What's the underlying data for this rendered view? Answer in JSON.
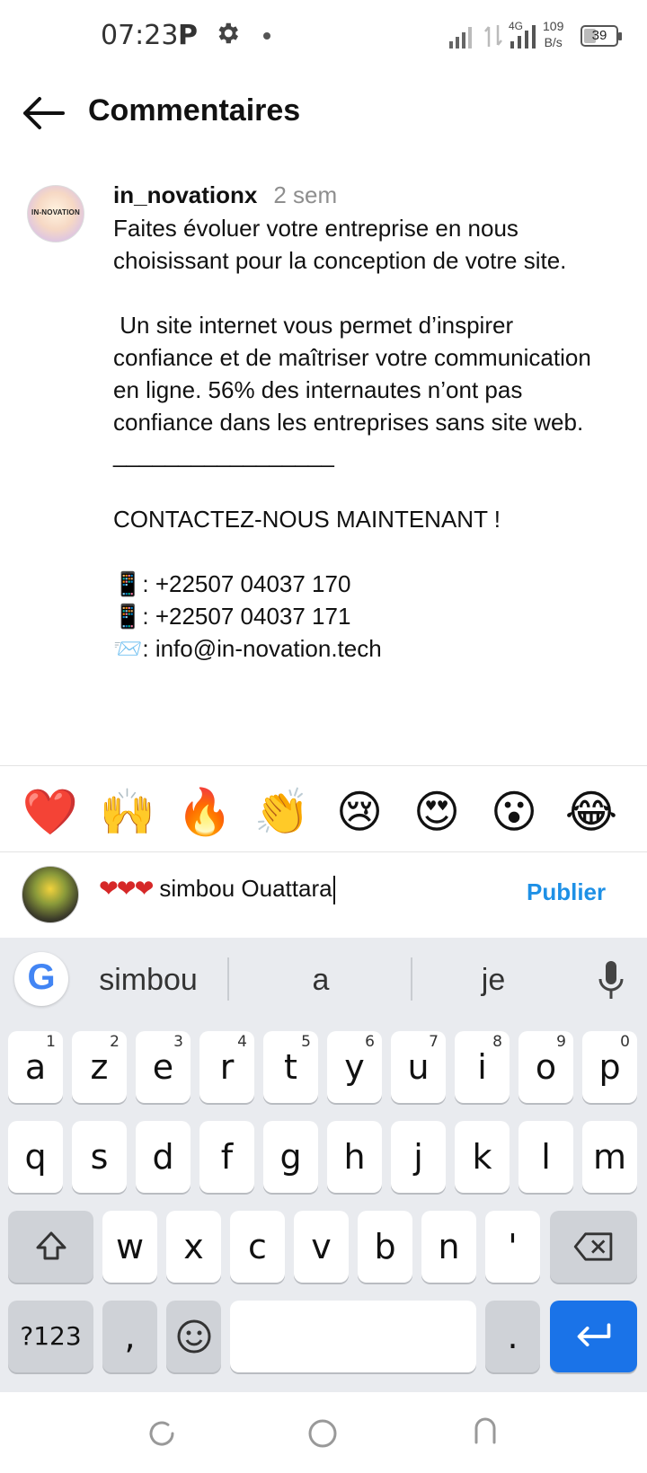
{
  "status_bar": {
    "time": "07:23",
    "notification_letter": "P",
    "network_label": "4G",
    "speed_value": "109",
    "speed_unit": "B/s",
    "battery_level": "39",
    "icons": [
      "gear-icon",
      "signal-icon",
      "data-arrows-icon",
      "battery-icon"
    ]
  },
  "header": {
    "title": "Commentaires",
    "back_icon": "arrow-left-icon"
  },
  "post": {
    "avatar_text": "IN-NOVATION",
    "username": "in_novationx",
    "time": "2 sem",
    "caption": "Faites évoluer votre entreprise en nous choisissant pour la conception de votre site.\n\n Un site internet vous permet d’inspirer confiance et de maîtriser votre communication en ligne. 56% des internautes n’ont pas confiance dans les entreprises sans site web.\n_________________\n\nCONTACTEZ-NOUS MAINTENANT !\n\n📱: +22507 04037 170\n📱: +22507 04037 171\n📨: info@in-novation.tech"
  },
  "emoji_bar": [
    "❤️",
    "🙌",
    "🔥",
    "👏",
    "😢",
    "😍",
    "😮",
    "😂"
  ],
  "comment": {
    "hearts": "❤❤❤",
    "text": "simbou Ouattara",
    "publish_label": "Publier"
  },
  "keyboard": {
    "google_letter": "G",
    "suggestions": [
      "simbou",
      "a",
      "je"
    ],
    "row1": [
      {
        "k": "a",
        "n": "1"
      },
      {
        "k": "z",
        "n": "2"
      },
      {
        "k": "e",
        "n": "3"
      },
      {
        "k": "r",
        "n": "4"
      },
      {
        "k": "t",
        "n": "5"
      },
      {
        "k": "y",
        "n": "6"
      },
      {
        "k": "u",
        "n": "7"
      },
      {
        "k": "i",
        "n": "8"
      },
      {
        "k": "o",
        "n": "9"
      },
      {
        "k": "p",
        "n": "0"
      }
    ],
    "row2": [
      "q",
      "s",
      "d",
      "f",
      "g",
      "h",
      "j",
      "k",
      "l",
      "m"
    ],
    "row3": [
      "w",
      "x",
      "c",
      "v",
      "b",
      "n",
      "'"
    ],
    "symbols_label": "?123",
    "comma_label": ",",
    "period_label": "."
  }
}
